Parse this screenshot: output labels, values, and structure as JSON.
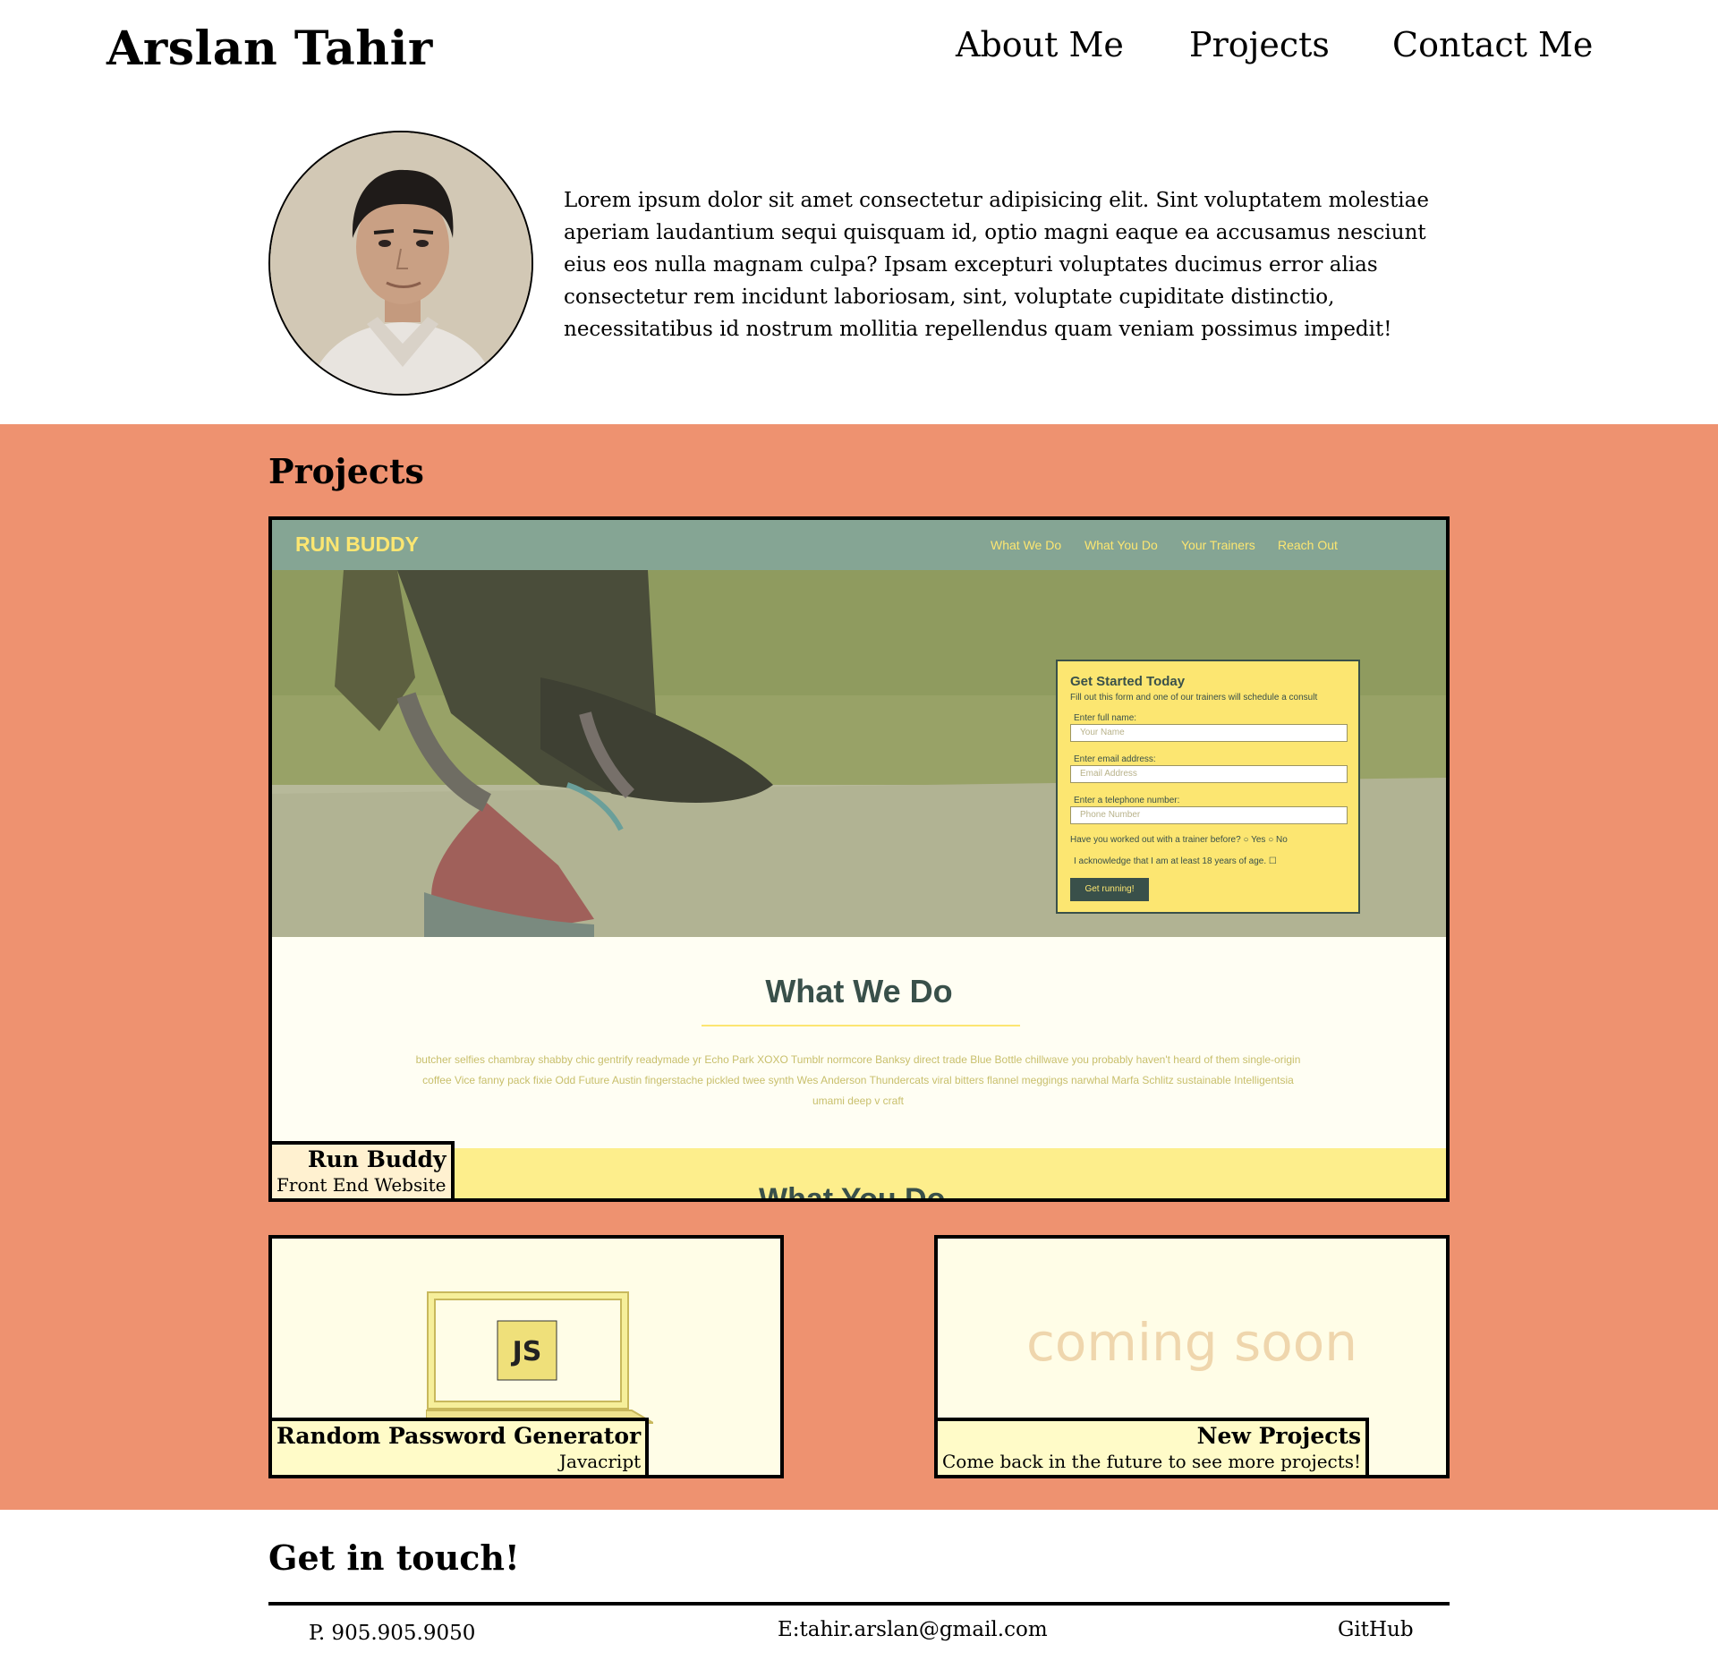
{
  "header": {
    "brand": "Arslan Tahir",
    "nav": [
      "About Me",
      "Projects",
      "Contact Me"
    ]
  },
  "about": {
    "text": "Lorem ipsum dolor sit amet consectetur adipisicing elit. Sint voluptatem molestiae aperiam laudantium sequi quisquam id, optio magni eaque ea accusamus nesciunt eius eos nulla magnam culpa? Ipsam excepturi voluptates ducimus error alias consectetur rem incidunt laboriosam, sint, voluptate cupiditate distinctio, necessitatibus id nostrum mollitia repellendus quam veniam possimus impedit!"
  },
  "projects": {
    "heading": "Projects",
    "featured": {
      "title": "Run Buddy",
      "subtitle": "Front End Website",
      "preview": {
        "logo": "RUN BUDDY",
        "nav": [
          "What We Do",
          "What You Do",
          "Your Trainers",
          "Reach Out"
        ],
        "form_title": "Get Started Today",
        "form_subtitle": "Fill out this form and one of our trainers will schedule a consult",
        "fields": [
          {
            "label": "Enter full name:",
            "placeholder": "Your Name"
          },
          {
            "label": "Enter email address:",
            "placeholder": "Email Address"
          },
          {
            "label": "Enter a telephone number:",
            "placeholder": "Phone Number"
          }
        ],
        "question": "Have you worked out with a trainer before?",
        "yes": "Yes",
        "no": "No",
        "acknowledge": "I acknowledge that I am at least 18 years of age.",
        "button": "Get running!",
        "section_title": "What We Do",
        "section_text": "butcher selfies chambray shabby chic gentrify readymade yr Echo Park XOXO Tumblr normcore Banksy direct trade Blue Bottle chillwave you probably haven't heard of them single-origin coffee Vice fanny pack fixie Odd Future Austin fingerstache pickled twee synth Wes Anderson Thundercats viral bitters flannel meggings narwhal Marfa Schlitz sustainable Intelligentsia umami deep v craft",
        "next_section": "What You Do"
      }
    },
    "items": [
      {
        "title": "Random Password Generator",
        "subtitle": "Javacript",
        "badge": "JS"
      },
      {
        "title": "New Projects",
        "subtitle": "Come back in the future to see more projects!",
        "placeholder_text": "coming soon"
      }
    ]
  },
  "contact": {
    "heading": "Get in touch!",
    "phone": "P. 905.905.9050",
    "email": "E:tahir.arslan@gmail.com",
    "github": "GitHub"
  },
  "colors": {
    "projects_bg": "#ee9270",
    "card_bg": "#fffde7",
    "runbuddy_green": "#85a594",
    "runbuddy_yellow": "#fce671",
    "runbuddy_dark": "#39504a"
  }
}
